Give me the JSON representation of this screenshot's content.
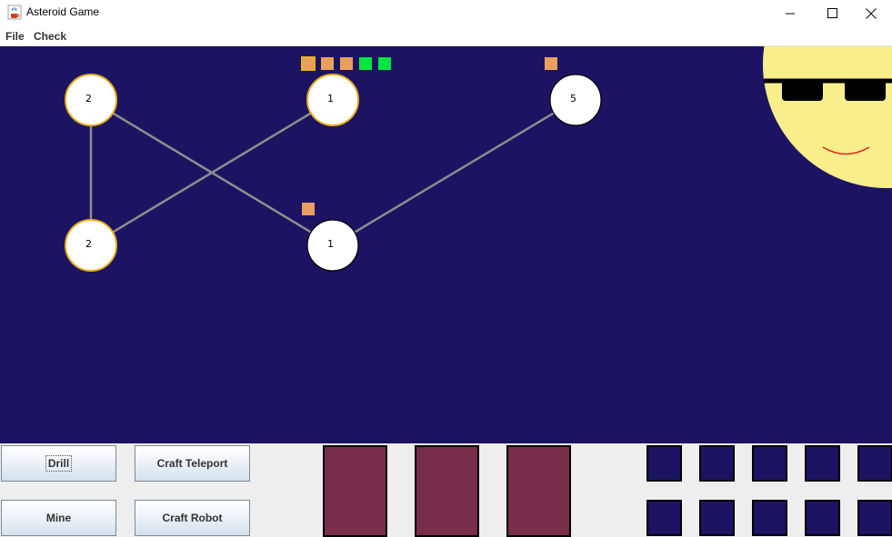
{
  "window": {
    "title": "Asteroid Game",
    "app_icon": "java-coffee-cup-icon",
    "controls": [
      "minimize-icon",
      "maximize-icon",
      "close-icon"
    ]
  },
  "menu": {
    "items": [
      "File",
      "Check"
    ]
  },
  "colors": {
    "space": "#1c1462",
    "asteroid_fill": "#ffffff",
    "asteroid_highlight_ring": "#e8b020",
    "asteroid_normal_ring": "#000000",
    "connection_line": "#8c8c8c",
    "marker_orange": "#e8a060",
    "marker_green": "#00e640",
    "sun": "#f8ee8c",
    "panel_bg": "#eeeeee",
    "slot_fill": "#782d4a",
    "inventory_fill": "#1c1462"
  },
  "asteroids": [
    {
      "id": "a",
      "label": "2",
      "highlighted": true
    },
    {
      "id": "b",
      "label": "1",
      "highlighted": true
    },
    {
      "id": "c",
      "label": "5",
      "highlighted": false
    },
    {
      "id": "d",
      "label": "2",
      "highlighted": true
    },
    {
      "id": "e",
      "label": "1",
      "highlighted": false
    }
  ],
  "connections": [
    [
      "a",
      "d"
    ],
    [
      "a",
      "e"
    ],
    [
      "d",
      "b"
    ],
    [
      "e",
      "c"
    ]
  ],
  "markers": [
    {
      "kind": "orange",
      "selected": true
    },
    {
      "kind": "orange",
      "selected": false
    },
    {
      "kind": "orange",
      "selected": false
    },
    {
      "kind": "green",
      "selected": false
    },
    {
      "kind": "green",
      "selected": false
    },
    {
      "kind": "orange",
      "selected": false
    },
    {
      "kind": "orange",
      "selected": false
    }
  ],
  "sun": {
    "icon": "sun-with-sunglasses-icon"
  },
  "controls": {
    "drill_label": "Drill",
    "mine_label": "Mine",
    "craft_teleport_label": "Craft Teleport",
    "craft_robot_label": "Craft Robot"
  },
  "slots_count": 3,
  "inventory_count": 10
}
